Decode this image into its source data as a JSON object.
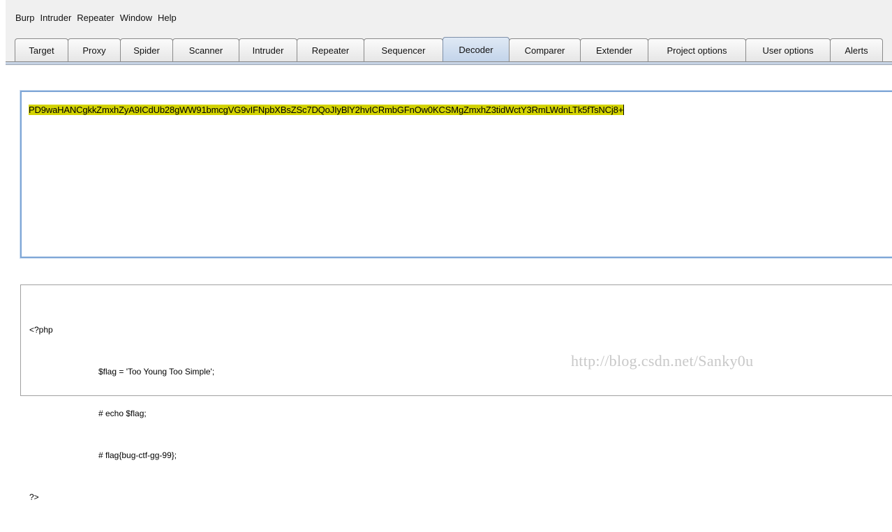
{
  "menubar": {
    "items": [
      "Burp",
      "Intruder",
      "Repeater",
      "Window",
      "Help"
    ]
  },
  "tabs": [
    {
      "label": "Target"
    },
    {
      "label": "Proxy"
    },
    {
      "label": "Spider"
    },
    {
      "label": "Scanner"
    },
    {
      "label": "Intruder"
    },
    {
      "label": "Repeater"
    },
    {
      "label": "Sequencer"
    },
    {
      "label": "Decoder",
      "active": true
    },
    {
      "label": "Comparer"
    },
    {
      "label": "Extender"
    },
    {
      "label": "Project options"
    },
    {
      "label": "User options"
    },
    {
      "label": "Alerts"
    }
  ],
  "decoder": {
    "input_text": "PD9waHANCgkkZmxhZyA9ICdUb28gWW91bmcgVG9vIFNpbXBsZSc7DQoJIyBlY2hvICRmbGFnOw0KCSMgZmxhZ3tidWctY3RmLWdnLTk5fTsNCj8+",
    "output_lines": [
      "<?php",
      "\t$flag = 'Too Young Too Simple';",
      "\t# echo $flag;",
      "\t# flag{bug-ctf-gg-99};",
      "?>"
    ],
    "highlight_color": "#d3d300"
  },
  "watermark": "http://blog.csdn.net/Sanky0u"
}
